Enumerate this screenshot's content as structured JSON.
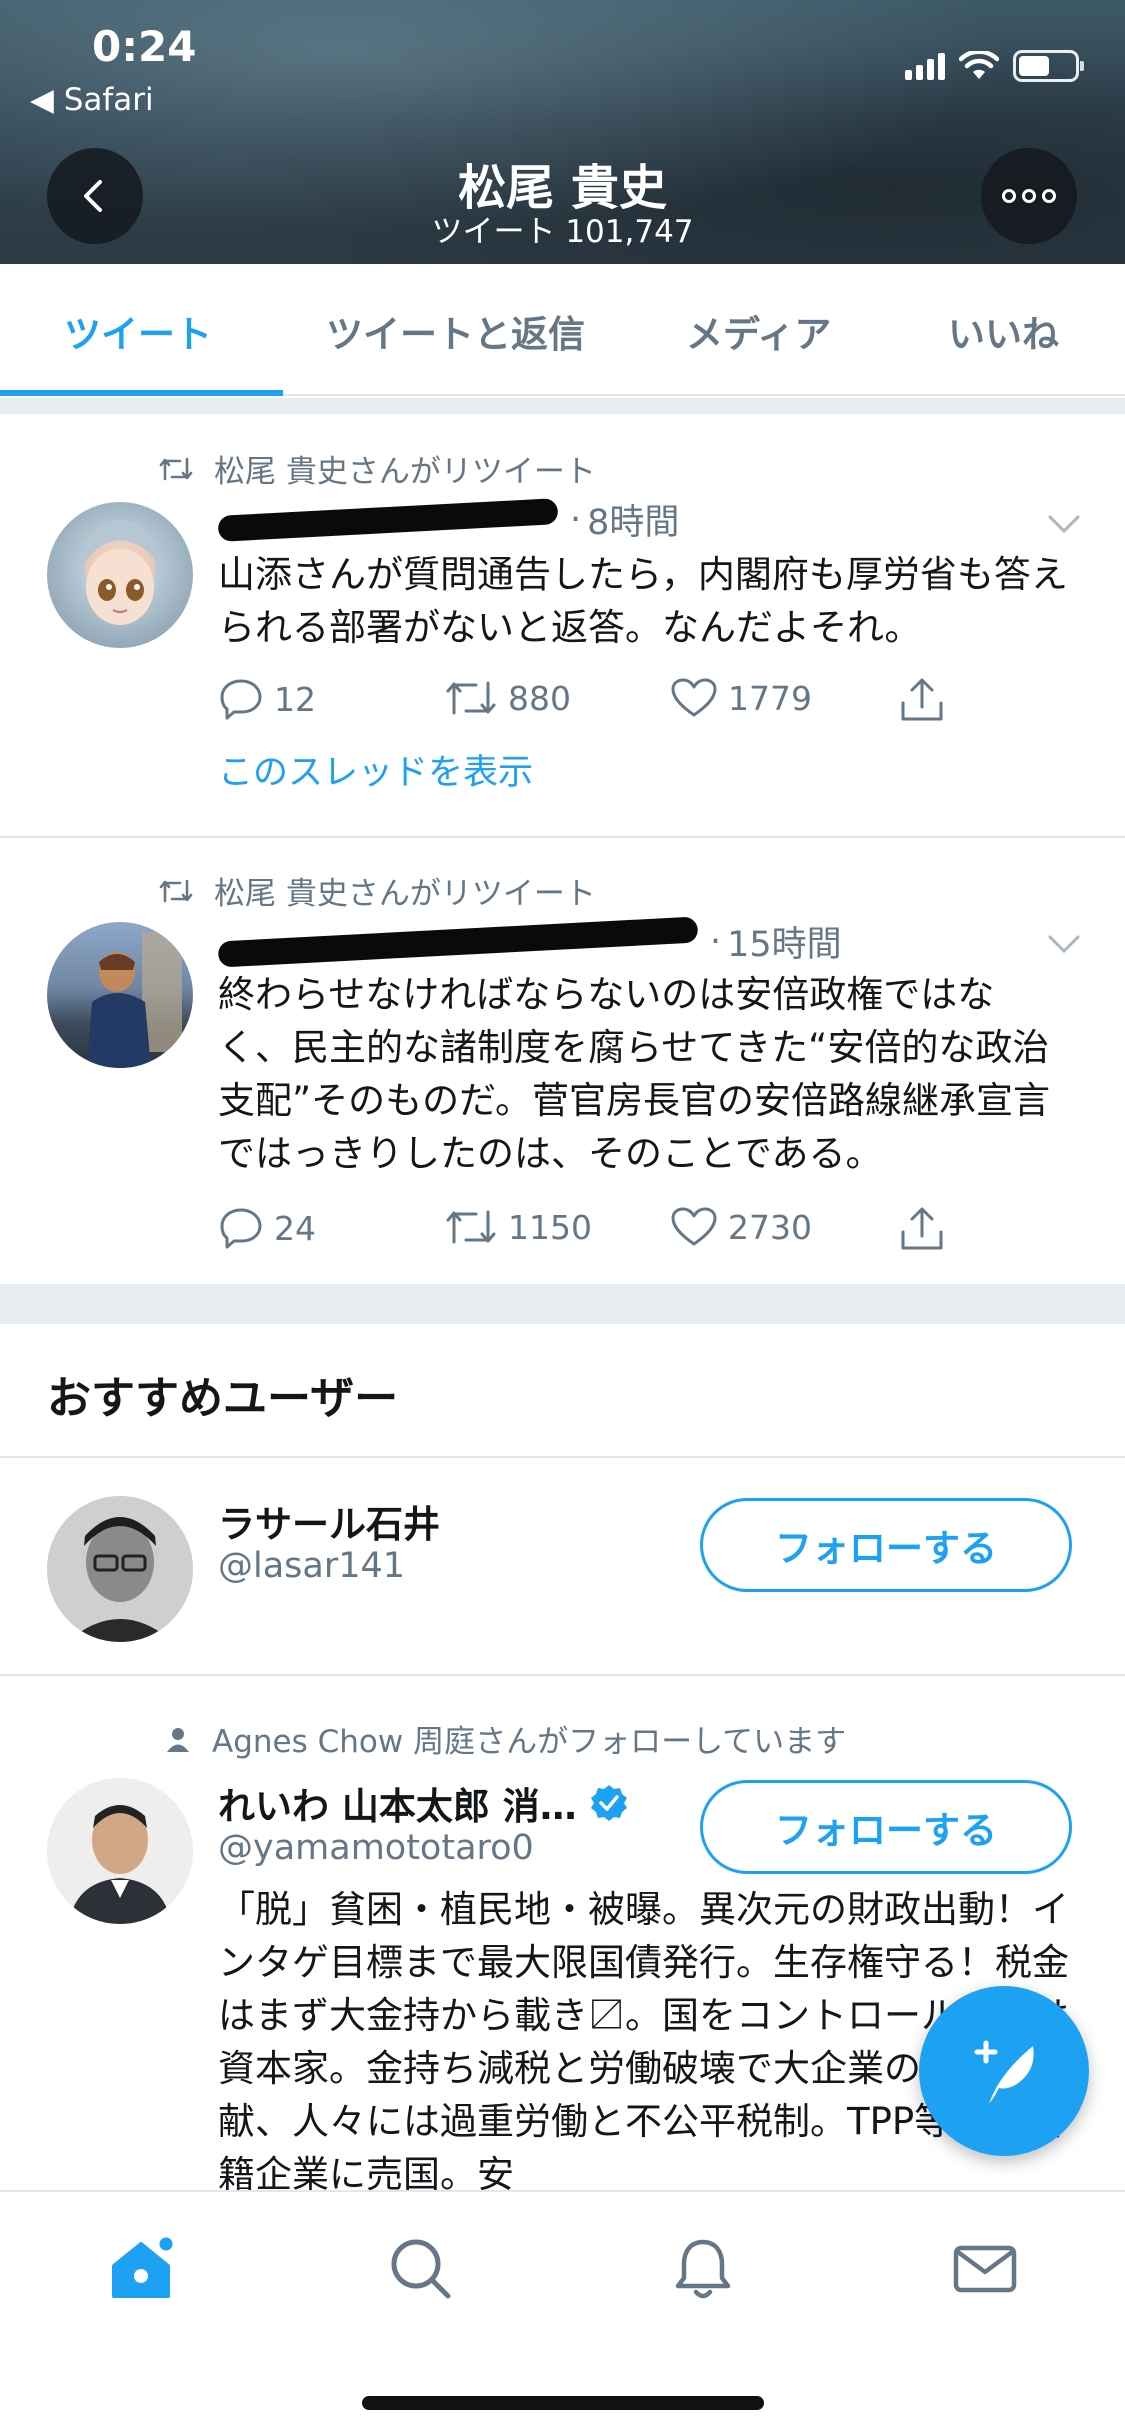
{
  "status_bar": {
    "time": "0:24",
    "back_app": "◀ Safari"
  },
  "profile_header": {
    "name": "松尾 貴史",
    "tweet_count": "ツイート 101,747"
  },
  "tabs": [
    {
      "label": "ツイート",
      "active": true
    },
    {
      "label": "ツイートと返信",
      "active": false
    },
    {
      "label": "メディア",
      "active": false
    },
    {
      "label": "いいね",
      "active": false
    }
  ],
  "tweets": [
    {
      "retweet_context": "松尾 貴史さんがリツイート",
      "time": "8時間",
      "text": "山添さんが質問通告したら，内閣府も厚労省も答えられる部署がないと返答。なんだよそれ。",
      "replies": "12",
      "retweets": "880",
      "likes": "1779",
      "show_thread": "このスレッドを表示"
    },
    {
      "retweet_context": "松尾 貴史さんがリツイート",
      "time": "15時間",
      "text": "終わらせなければならないのは安倍政権ではなく、民主的な諸制度を腐らせてきた“安倍的な政治支配”そのものだ。菅官房長官の安倍路線継承宣言ではっきりしたのは、そのことである。",
      "replies": "24",
      "retweets": "1150",
      "likes": "2730"
    }
  ],
  "recommended": {
    "title": "おすすめユーザー",
    "users": [
      {
        "name": "ラサール石井",
        "handle": "@lasar141",
        "follow_label": "フォローする"
      },
      {
        "context": "Agnes Chow 周庭さんがフォローしています",
        "name": "れいわ 山本太郎 消…",
        "handle": "@yamamototaro0",
        "follow_label": "フォローする",
        "bio": "「脱」貧困・植民地・被曝。異次元の財政出動！インタゲ目標まで最大限国債発行。生存権守る！税金はまず大金持から載き〼。国をコントロールするは資本家。金持ち減税と労働破壊で大企業の利益に貢献、人々には過重労働と不公平税制。TPP等で多国籍企業に売国。安"
      }
    ]
  },
  "colors": {
    "accent": "#1da1f2",
    "secondary_text": "#657786",
    "divider": "#e1e8ed"
  },
  "icons": [
    "back-arrow-icon",
    "more-icon",
    "retweet-icon",
    "reply-icon",
    "like-icon",
    "share-icon",
    "verified-icon",
    "compose-tweet-icon",
    "home-icon",
    "search-icon",
    "notifications-icon",
    "messages-icon"
  ]
}
